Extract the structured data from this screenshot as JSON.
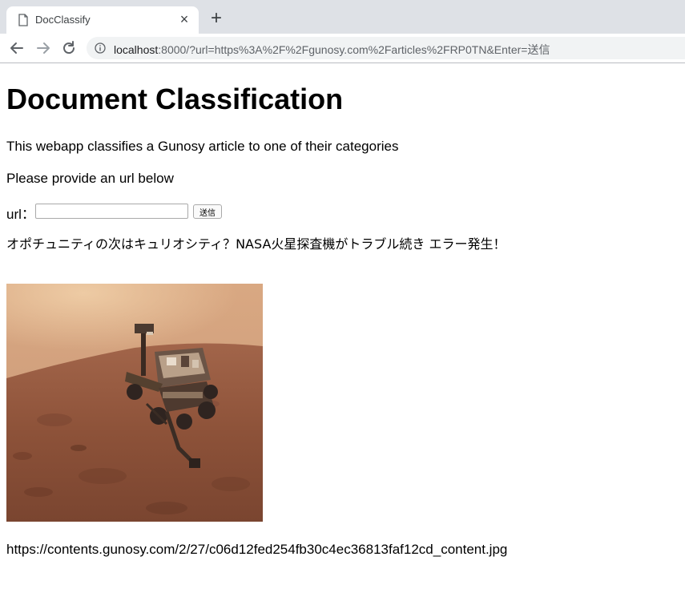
{
  "browser": {
    "tab_title": "DocClassify",
    "close_glyph": "×",
    "new_tab_glyph": "+",
    "url_host": "localhost",
    "url_rest": ":8000/?url=https%3A%2F%2Fgunosy.com%2Farticles%2FRP0TN&Enter=送信",
    "icons": [
      "document-icon",
      "close-icon",
      "plus-icon",
      "arrow-back-icon",
      "arrow-forward-icon",
      "reload-icon",
      "info-icon"
    ]
  },
  "page": {
    "heading": "Document Classification",
    "intro": "This webapp classifies a Gunosy article to one of their categories",
    "prompt": "Please provide an url below",
    "form": {
      "label": "url：",
      "input_value": "",
      "submit_label": "送信"
    },
    "article_title": "オポチュニティの次はキュリオシティ？NASA火星探査機がトラブル続き エラー発生！",
    "image_url_text": "https://contents.gunosy.com/2/27/c06d12fed254fb30c4ec36813faf12cd_content.jpg"
  }
}
